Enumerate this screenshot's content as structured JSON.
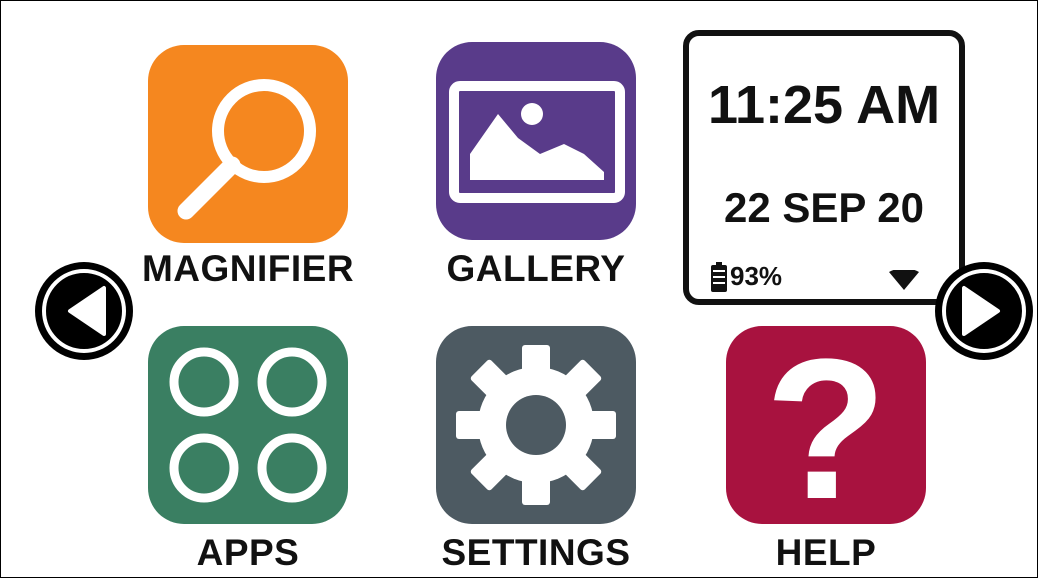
{
  "tiles": {
    "magnifier": {
      "label": "MAGNIFIER",
      "icon": "magnifier-icon",
      "color": "#F5871F"
    },
    "gallery": {
      "label": "GALLERY",
      "icon": "image-icon",
      "color": "#593B8A"
    },
    "apps": {
      "label": "APPS",
      "icon": "apps-grid-icon",
      "color": "#3A7F62"
    },
    "settings": {
      "label": "SETTINGS",
      "icon": "gear-icon",
      "color": "#4D5A62"
    },
    "help": {
      "label": "HELP",
      "icon": "question-icon",
      "color": "#A8123F"
    }
  },
  "status": {
    "time": "11:25 AM",
    "date": "22 SEP 20",
    "battery": "93%",
    "battery_icon": "battery-icon",
    "wifi_icon": "wifi-icon"
  },
  "nav": {
    "prev_icon": "chevron-left-icon",
    "next_icon": "chevron-right-icon"
  }
}
